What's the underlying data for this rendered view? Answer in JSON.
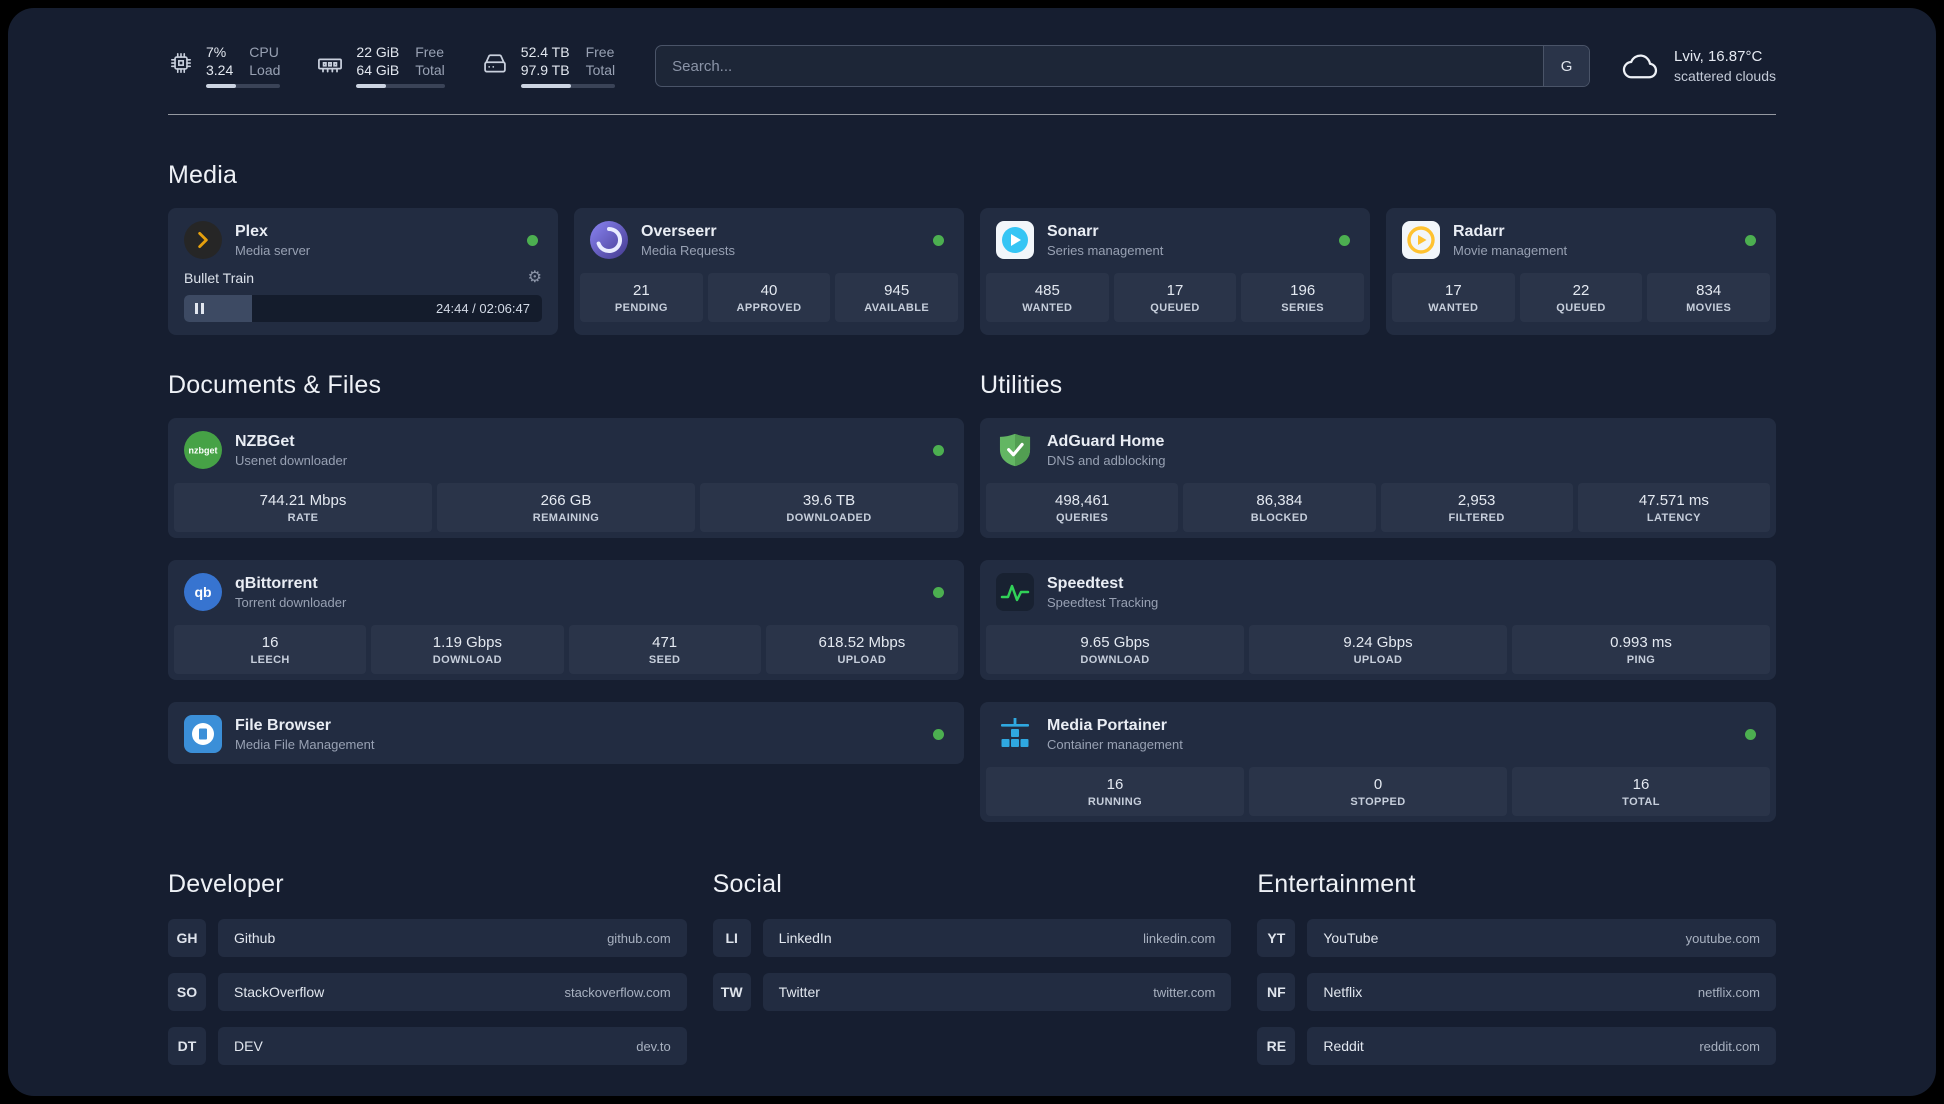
{
  "colors": {
    "page_bg": "#161e30",
    "card_bg": "#222c41",
    "tile_bg": "#2a3449",
    "status_online": "#4caf50",
    "accent_plex": "#e5a00d",
    "accent_overseerr": "#6d63d0",
    "accent_sonarr": "#35c5f4",
    "accent_radarr": "#ffc230",
    "accent_nzbget": "#46a246",
    "accent_qbittorrent": "#3774d0",
    "accent_filebrowser": "#3b8fd8",
    "accent_adguard": "#63b663",
    "accent_speedtest": "#31d158",
    "accent_portainer": "#2fa8e0"
  },
  "topbar": {
    "stats": [
      {
        "name": "cpu",
        "value": "7%",
        "sub": "3.24",
        "label_top": "CPU",
        "label_bottom": "Load",
        "fill_pct": 40
      },
      {
        "name": "memory",
        "value": "22 GiB",
        "sub": "64 GiB",
        "label_top": "Free",
        "label_bottom": "Total",
        "fill_pct": 34
      },
      {
        "name": "disk",
        "value": "52.4 TB",
        "sub": "97.9 TB",
        "label_top": "Free",
        "label_bottom": "Total",
        "fill_pct": 53
      }
    ],
    "search": {
      "placeholder": "Search...",
      "engine_button": "G"
    },
    "weather": {
      "location": "Lviv, 16.87°C",
      "condition": "scattered clouds"
    }
  },
  "sections": {
    "media": {
      "title": "Media",
      "plex": {
        "name": "Plex",
        "subtitle": "Media server",
        "player": {
          "track": "Bullet Train",
          "time_display": "24:44 / 02:06:47",
          "progress_pct": 19
        }
      },
      "overseerr": {
        "name": "Overseerr",
        "subtitle": "Media Requests",
        "stats": [
          {
            "value": "21",
            "label": "PENDING"
          },
          {
            "value": "40",
            "label": "APPROVED"
          },
          {
            "value": "945",
            "label": "AVAILABLE"
          }
        ]
      },
      "sonarr": {
        "name": "Sonarr",
        "subtitle": "Series management",
        "stats": [
          {
            "value": "485",
            "label": "WANTED"
          },
          {
            "value": "17",
            "label": "QUEUED"
          },
          {
            "value": "196",
            "label": "SERIES"
          }
        ]
      },
      "radarr": {
        "name": "Radarr",
        "subtitle": "Movie management",
        "stats": [
          {
            "value": "17",
            "label": "WANTED"
          },
          {
            "value": "22",
            "label": "QUEUED"
          },
          {
            "value": "834",
            "label": "MOVIES"
          }
        ]
      }
    },
    "documents": {
      "title": "Documents & Files",
      "nzbget": {
        "name": "NZBGet",
        "subtitle": "Usenet downloader",
        "stats": [
          {
            "value": "744.21 Mbps",
            "label": "RATE"
          },
          {
            "value": "266 GB",
            "label": "REMAINING"
          },
          {
            "value": "39.6 TB",
            "label": "DOWNLOADED"
          }
        ]
      },
      "qbittorrent": {
        "name": "qBittorrent",
        "subtitle": "Torrent downloader",
        "stats": [
          {
            "value": "16",
            "label": "LEECH"
          },
          {
            "value": "1.19 Gbps",
            "label": "DOWNLOAD"
          },
          {
            "value": "471",
            "label": "SEED"
          },
          {
            "value": "618.52 Mbps",
            "label": "UPLOAD"
          }
        ]
      },
      "filebrowser": {
        "name": "File Browser",
        "subtitle": "Media File Management"
      }
    },
    "utilities": {
      "title": "Utilities",
      "adguard": {
        "name": "AdGuard Home",
        "subtitle": "DNS and adblocking",
        "stats": [
          {
            "value": "498,461",
            "label": "QUERIES"
          },
          {
            "value": "86,384",
            "label": "BLOCKED"
          },
          {
            "value": "2,953",
            "label": "FILTERED"
          },
          {
            "value": "47.571 ms",
            "label": "LATENCY"
          }
        ]
      },
      "speedtest": {
        "name": "Speedtest",
        "subtitle": "Speedtest Tracking",
        "stats": [
          {
            "value": "9.65 Gbps",
            "label": "DOWNLOAD"
          },
          {
            "value": "9.24 Gbps",
            "label": "UPLOAD"
          },
          {
            "value": "0.993 ms",
            "label": "PING"
          }
        ]
      },
      "portainer": {
        "name": "Media Portainer",
        "subtitle": "Container management",
        "stats": [
          {
            "value": "16",
            "label": "RUNNING"
          },
          {
            "value": "0",
            "label": "STOPPED"
          },
          {
            "value": "16",
            "label": "TOTAL"
          }
        ]
      }
    },
    "developer": {
      "title": "Developer",
      "links": [
        {
          "abbr": "GH",
          "name": "Github",
          "url": "github.com"
        },
        {
          "abbr": "SO",
          "name": "StackOverflow",
          "url": "stackoverflow.com"
        },
        {
          "abbr": "DT",
          "name": "DEV",
          "url": "dev.to"
        }
      ]
    },
    "social": {
      "title": "Social",
      "links": [
        {
          "abbr": "LI",
          "name": "LinkedIn",
          "url": "linkedin.com"
        },
        {
          "abbr": "TW",
          "name": "Twitter",
          "url": "twitter.com"
        }
      ]
    },
    "entertainment": {
      "title": "Entertainment",
      "links": [
        {
          "abbr": "YT",
          "name": "YouTube",
          "url": "youtube.com"
        },
        {
          "abbr": "NF",
          "name": "Netflix",
          "url": "netflix.com"
        },
        {
          "abbr": "RE",
          "name": "Reddit",
          "url": "reddit.com"
        }
      ]
    }
  }
}
